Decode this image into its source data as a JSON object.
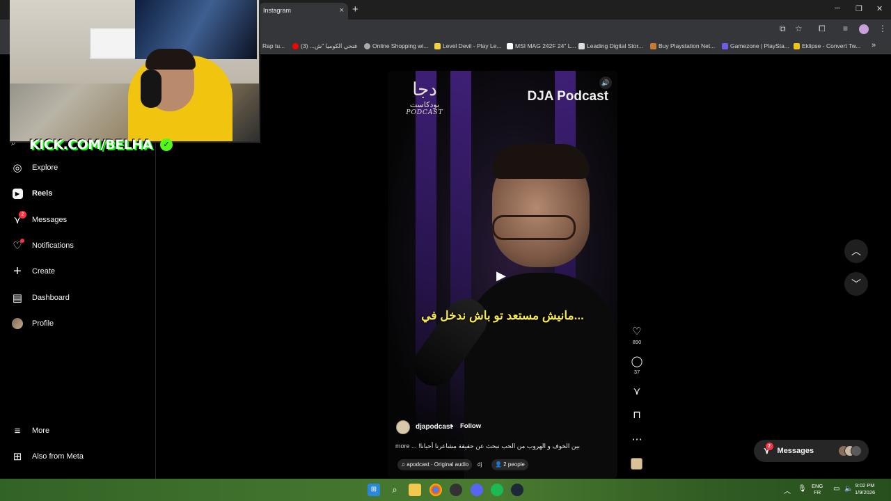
{
  "browser": {
    "tab_title": "Instagram",
    "tab_close": "×",
    "new_tab": "+",
    "window_controls": [
      "─",
      "❐",
      "✕"
    ],
    "bookmarks": [
      {
        "label": "Rap tu...",
        "icon_color": "#555555"
      },
      {
        "label": "فتحي الكوميا \"ش... (3)",
        "icon_color": "#ff0000"
      },
      {
        "label": "Online Shopping wi...",
        "icon_color": "#aaaaaa"
      },
      {
        "label": "Level Devil - Play Le...",
        "icon_color": "#f4d03f"
      },
      {
        "label": "MSI MAG 242F 24\" L...",
        "icon_color": "#ffffff"
      },
      {
        "label": "Leading Digital Stor...",
        "icon_color": "#dddddd"
      },
      {
        "label": "Buy Playstation Net...",
        "icon_color": "#c97b2b"
      },
      {
        "label": "Gamezone | PlaySta...",
        "icon_color": "#6c5ce7"
      },
      {
        "label": "Eklipse - Convert Tw...",
        "icon_color": "#f1c40f"
      }
    ],
    "overflow": "»"
  },
  "stream_overlay": {
    "channel": "KICK.COM/BELHA"
  },
  "sidebar": {
    "items": [
      {
        "label": "Explore",
        "icon": "compass-icon",
        "glyph": "◎"
      },
      {
        "label": "Reels",
        "icon": "reels-icon",
        "glyph": "▶"
      },
      {
        "label": "Messages",
        "icon": "messages-icon",
        "glyph": "⋎",
        "badge": "2"
      },
      {
        "label": "Notifications",
        "icon": "heart-icon",
        "glyph": "♡"
      },
      {
        "label": "Create",
        "icon": "plus-icon",
        "glyph": "+"
      },
      {
        "label": "Dashboard",
        "icon": "dashboard-icon",
        "glyph": "▤"
      },
      {
        "label": "Profile",
        "icon": "avatar"
      }
    ],
    "more": {
      "label": "More",
      "glyph": "≡"
    },
    "meta": {
      "label": "Also from Meta",
      "glyph": "⊞"
    }
  },
  "reel": {
    "logo_arabic": "دجا",
    "logo_arabic_sub": "بودكاست",
    "logo_english": "PODCAST",
    "title": "DJA Podcast",
    "subtitle": "مانيش مستعد تو باش ندخل في...",
    "username": "djapodcast",
    "separator": "•",
    "follow": "Follow",
    "caption": "بين الخوف و الهروب من الحب نبحث عن حقيقة مشاعرنا أحيانا!",
    "more": "more ...",
    "audio": "♫ apodcast · Original audio",
    "audio_tag": "dj",
    "people": "👤 2 people"
  },
  "actions": {
    "likes": "890",
    "comments": "37"
  },
  "floating_messages": {
    "label": "Messages",
    "badge": "2"
  },
  "taskbar": {
    "lang_top": "ENG",
    "lang_bottom": "FR",
    "time": "9:02 PM",
    "date": "1/9/2026"
  }
}
